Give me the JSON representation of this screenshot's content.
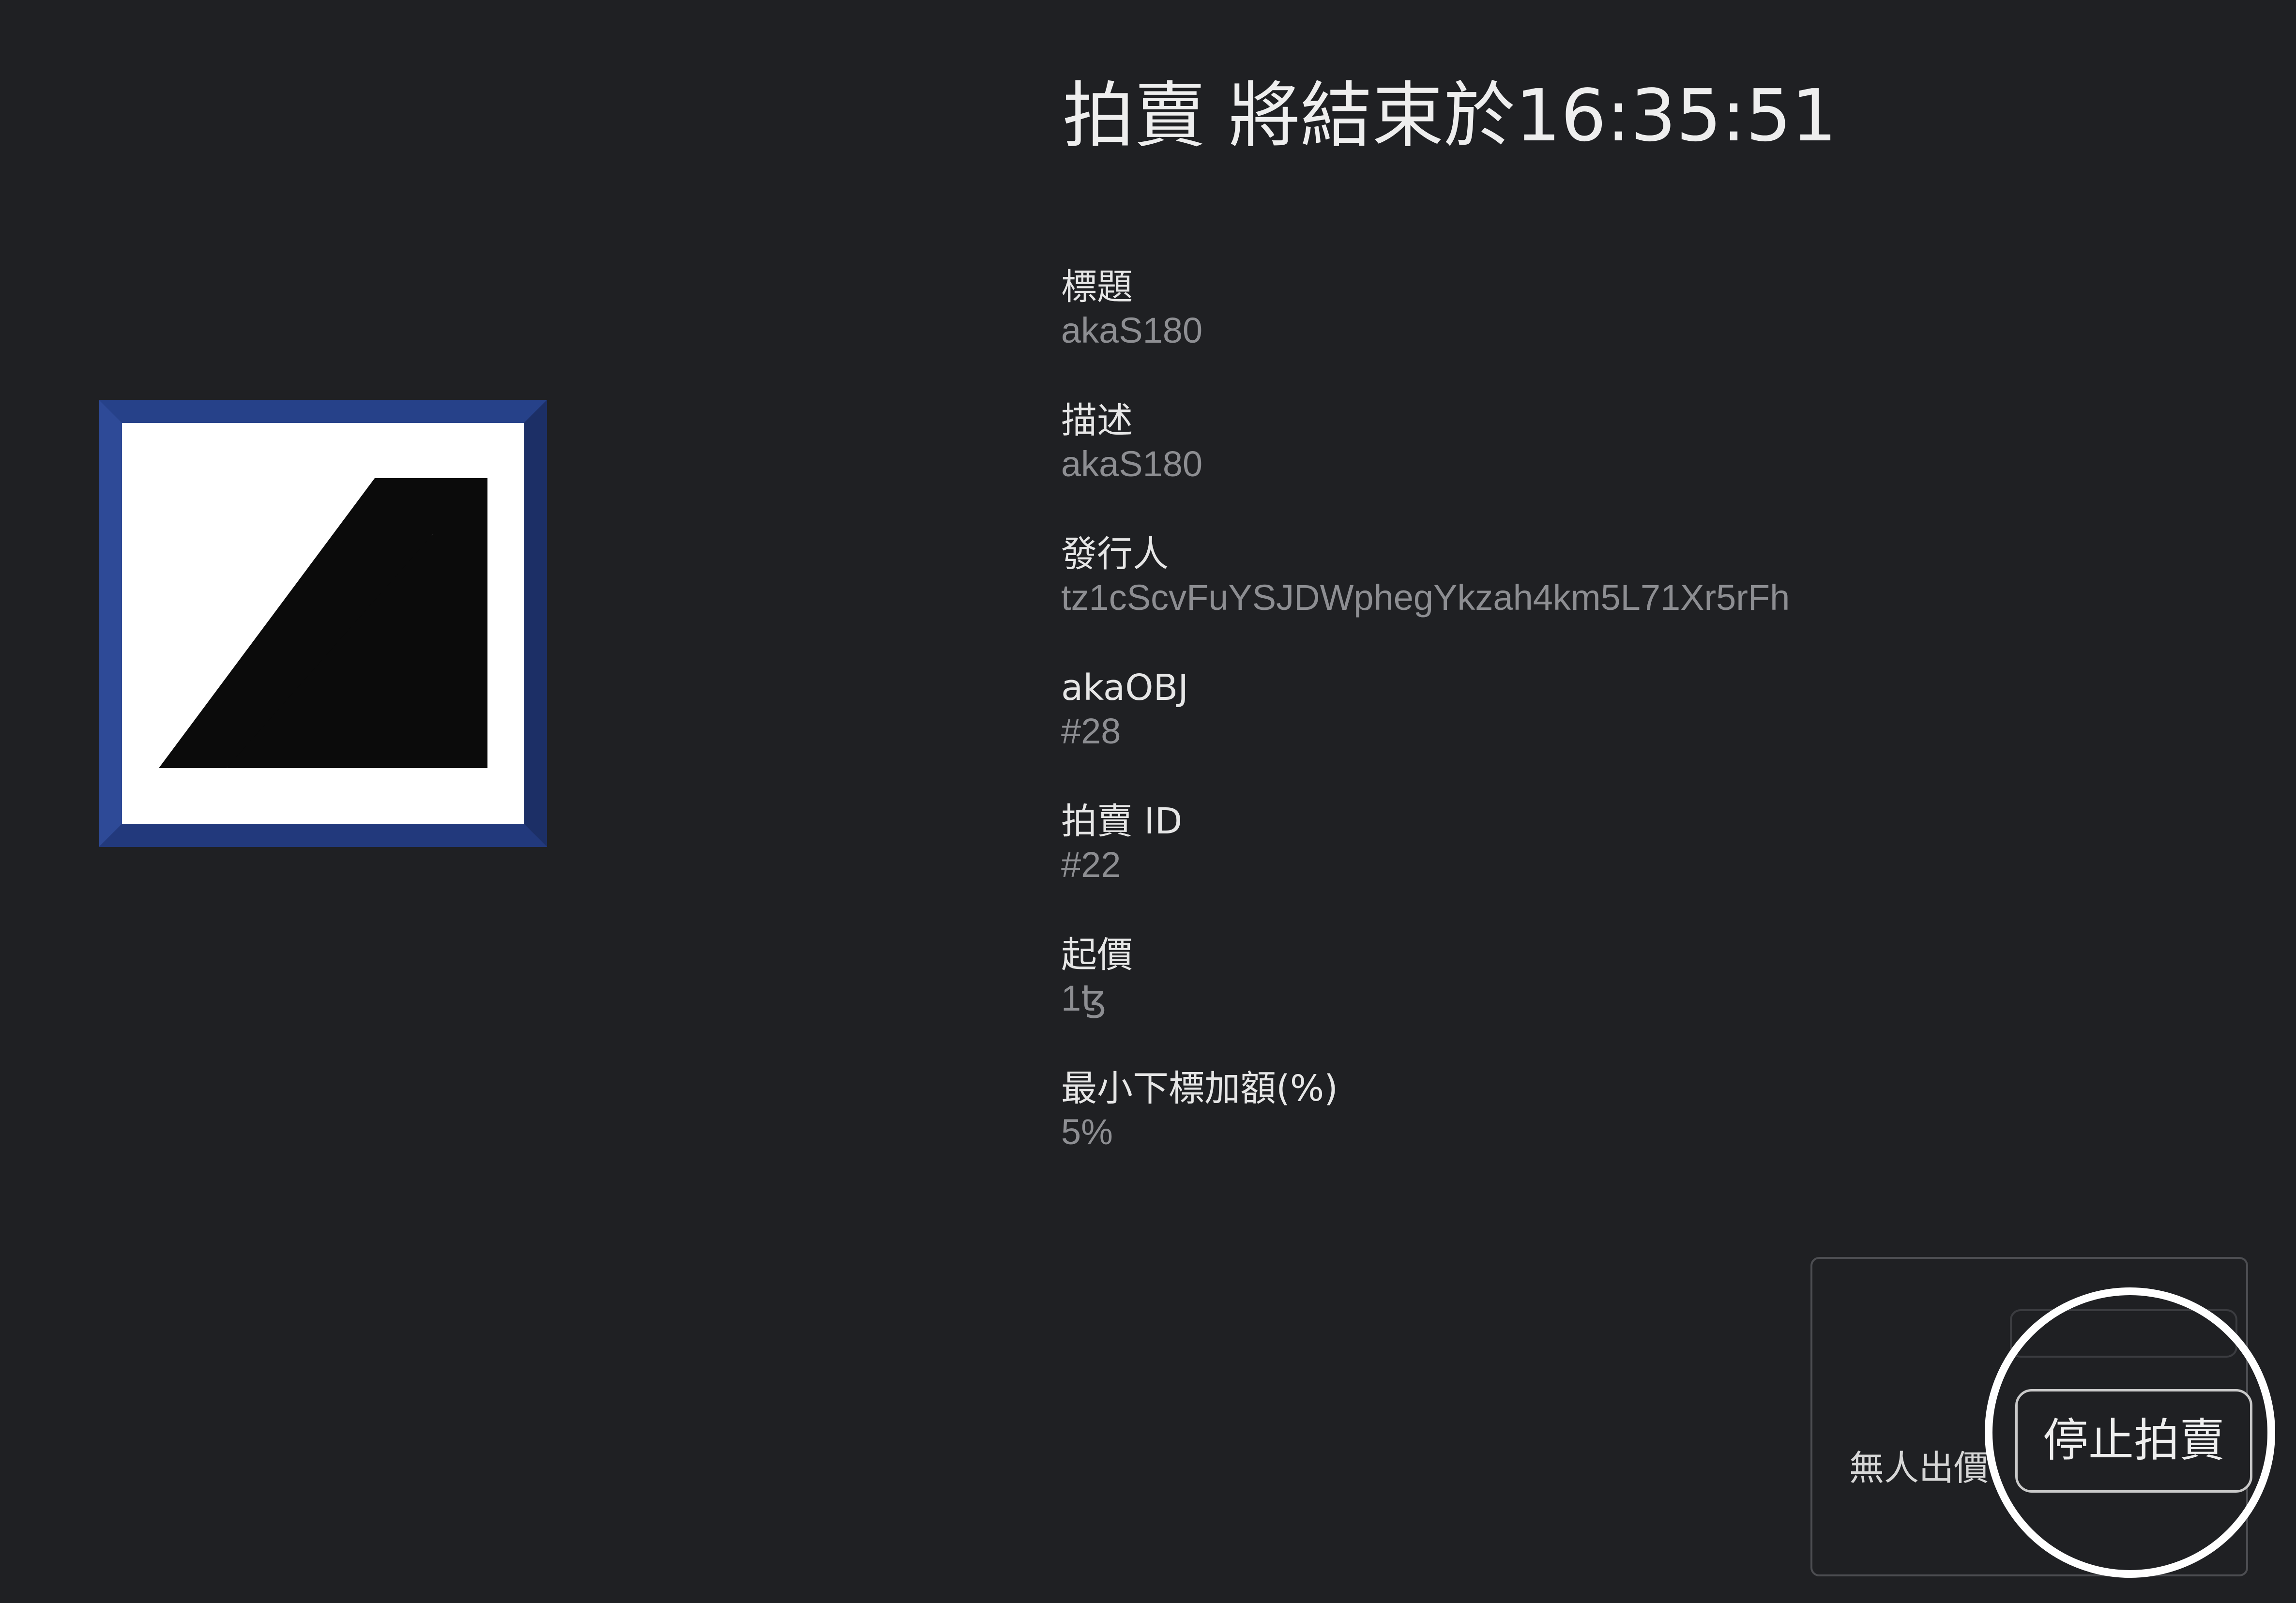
{
  "auction": {
    "heading": "拍賣 將結束於16:35:51"
  },
  "artwork": {
    "logo": "akaS180-logo-icon",
    "frame_color": "#2e4a97",
    "bevel_color": "#1c2f66"
  },
  "details": [
    {
      "label": "標題",
      "value": "akaS180"
    },
    {
      "label": "描述",
      "value": "akaS180"
    },
    {
      "label": "發行人",
      "value": "tz1cScvFuYSJDWphegYkzah4km5L71Xr5rFh"
    },
    {
      "label": "akaOBJ",
      "value": "#28"
    },
    {
      "label": "拍賣 ID",
      "value": "#22"
    },
    {
      "label": "起價",
      "value": "1ꜩ"
    },
    {
      "label": "最小下標加額(%)",
      "value": "5%"
    }
  ],
  "bid_panel": {
    "status": "無人出價",
    "stop_button": "停止拍賣"
  }
}
